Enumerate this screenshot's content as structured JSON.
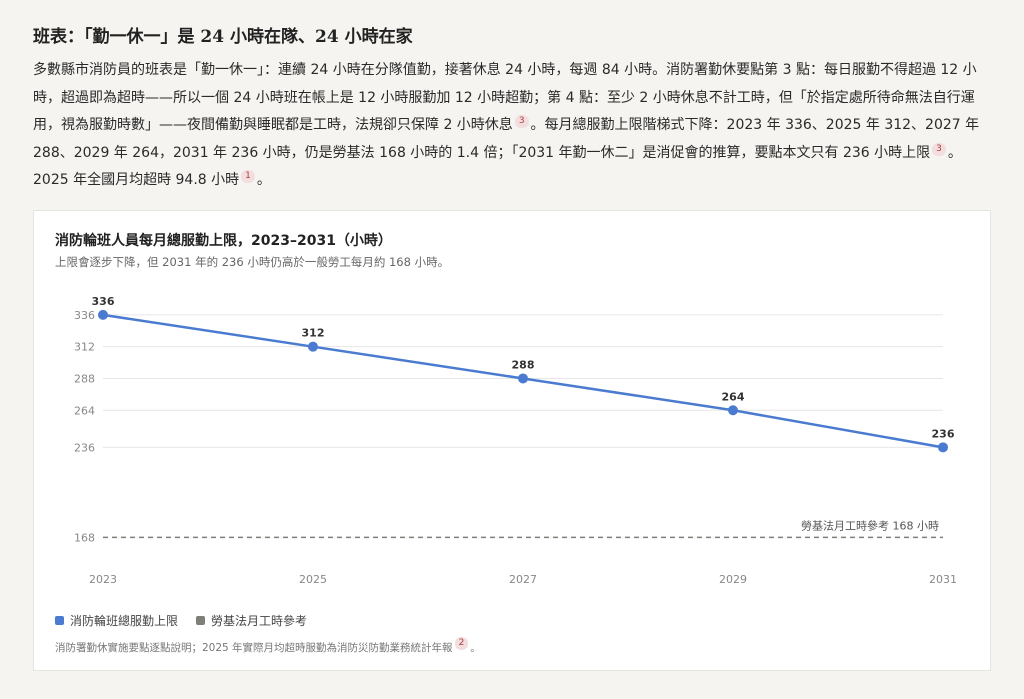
{
  "article": {
    "headline": "班表：「勤一休一」是 24 小時在隊、24 小時在家",
    "para_before_cite3a": "多數縣市消防員的班表是「勤一休一」：連續 24 小時在分隊值勤，接著休息 24 小時，每週 84 小時。消防署勤休要點第 3 點：每日服勤不得超過 12 小時，超過即為超時——所以一個 24 小時班在帳上是 12 小時服勤加 12 小時超勤；第 4 點：至少 2 小時休息不計工時，但「於指定處所待命無法自行運用，視為服勤時數」——夜間備勤與睡眠都是工時，法規卻只保障 2 小時休息",
    "cite3a": "3",
    "para_after_cite3a": "。每月總服勤上限階梯式下降：2023 年 336、2025 年 312、2027 年 288、2029 年 264，2031 年 236 小時，仍是勞基法 168 小時的 1.4 倍；「2031 年勤一休二」是消促會的推算，要點本文只有 236 小時上限",
    "cite3b": "3",
    "para_after_cite3b": "。2025 年全國月均超時 94.8 小時",
    "cite1": "1",
    "para_end": "。"
  },
  "chart_card": {
    "title": "消防輪班人員每月總服勤上限，2023–2031（小時）",
    "subtitle": "上限會逐步下降，但 2031 年的 236 小時仍高於一般勞工每月約 168 小時。",
    "legend": [
      {
        "label": "消防輪班總服勤上限",
        "color": "#4a7bd0"
      },
      {
        "label": "勞基法月工時參考",
        "color": "#7f7f79"
      }
    ],
    "source_text": "消防署勤休實施要點逐點說明；2025 年實際月均超時服勤為消防災防勤業務統計年報",
    "source_cite": "2",
    "source_end": "。"
  },
  "chart_data": {
    "type": "line",
    "title": "消防輪班人員每月總服勤上限，2023–2031（小時）",
    "subtitle": "上限會逐步下降，但 2031 年的 236 小時仍高於一般勞工每月約 168 小時。",
    "x": [
      2023,
      2025,
      2027,
      2029,
      2031
    ],
    "x_tick_labels": [
      "2023",
      "2025",
      "2027",
      "2029",
      "2031"
    ],
    "y_tick_labels": [
      "336",
      "312",
      "288",
      "264",
      "236",
      "168"
    ],
    "y_ticks": [
      336,
      312,
      288,
      264,
      236,
      168
    ],
    "ylim": [
      160,
      348
    ],
    "grid": true,
    "legend_position": "bottom-left",
    "series": [
      {
        "name": "消防輪班總服勤上限",
        "values": [
          336,
          312,
          288,
          264,
          236
        ],
        "data_labels": [
          "336",
          "312",
          "288",
          "264",
          "236"
        ],
        "color": "#4a7bd0"
      }
    ],
    "reference_line": {
      "name": "勞基法月工時參考",
      "value": 168,
      "label": "勞基法月工時參考 168 小時",
      "color": "#7f7f79",
      "style": "dashed"
    }
  }
}
